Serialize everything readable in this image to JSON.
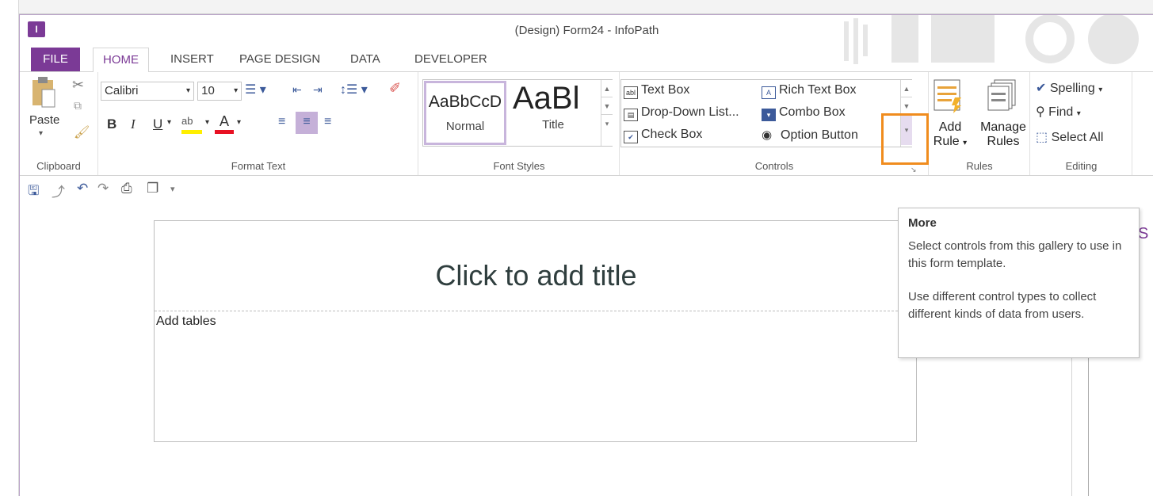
{
  "window": {
    "title": "(Design) Form24 - InfoPath",
    "app_icon": "infopath-icon"
  },
  "tabs": [
    {
      "label": "FILE"
    },
    {
      "label": "HOME"
    },
    {
      "label": "INSERT"
    },
    {
      "label": "PAGE DESIGN"
    },
    {
      "label": "DATA"
    },
    {
      "label": "DEVELOPER"
    }
  ],
  "clipboard": {
    "paste_label": "Paste",
    "group_label": "Clipboard"
  },
  "format_text": {
    "font_name": "Calibri",
    "font_size": "10",
    "bold": "B",
    "italic": "I",
    "underline": "U",
    "group_label": "Format Text"
  },
  "font_styles": {
    "items": [
      {
        "preview": "AaBbCcD",
        "label": "Normal"
      },
      {
        "preview": "AaBl",
        "label": "Title"
      }
    ],
    "group_label": "Font Styles"
  },
  "controls": {
    "items": [
      {
        "label": "Text Box",
        "icon": "text-box-icon"
      },
      {
        "label": "Rich Text Box",
        "icon": "rich-text-box-icon"
      },
      {
        "label": "Drop-Down List...",
        "icon": "drop-down-list-icon"
      },
      {
        "label": "Combo Box",
        "icon": "combo-box-icon"
      },
      {
        "label": "Check Box",
        "icon": "check-box-icon"
      },
      {
        "label": "Option Button",
        "icon": "option-button-icon"
      }
    ],
    "group_label": "Controls"
  },
  "rules": {
    "add_rule_line1": "Add",
    "add_rule_line2": "Rule",
    "manage_rules_line1": "Manage",
    "manage_rules_line2": "Rules",
    "group_label": "Rules"
  },
  "editing": {
    "spelling": "Spelling",
    "find": "Find",
    "select_all": "Select All",
    "group_label": "Editing"
  },
  "canvas": {
    "title_placeholder": "Click to add title",
    "body_text": "Add tables"
  },
  "tooltip": {
    "title": "More",
    "line1": "Select controls from this gallery to use in this form template.",
    "line2": "Use different control types to collect different kinds of data from users."
  },
  "colors": {
    "accent": "#7b3a96",
    "highlight": "#f08c1e"
  }
}
